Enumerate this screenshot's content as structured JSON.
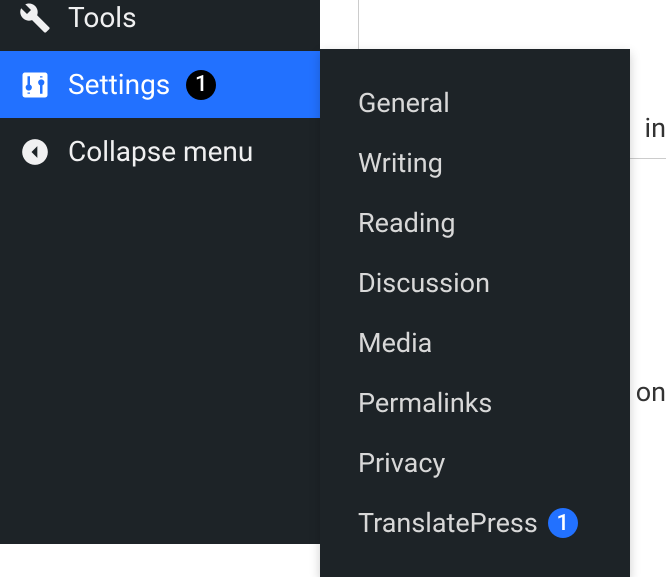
{
  "sidebar": {
    "items": [
      {
        "label": "Tools"
      },
      {
        "label": "Settings",
        "badge": "1"
      },
      {
        "label": "Collapse menu"
      }
    ]
  },
  "submenu": {
    "items": [
      {
        "label": "General"
      },
      {
        "label": "Writing"
      },
      {
        "label": "Reading"
      },
      {
        "label": "Discussion"
      },
      {
        "label": "Media"
      },
      {
        "label": "Permalinks"
      },
      {
        "label": "Privacy"
      },
      {
        "label": "TranslatePress",
        "badge": "1"
      }
    ]
  },
  "background": {
    "fragment1": "in",
    "fragment2": "on"
  }
}
